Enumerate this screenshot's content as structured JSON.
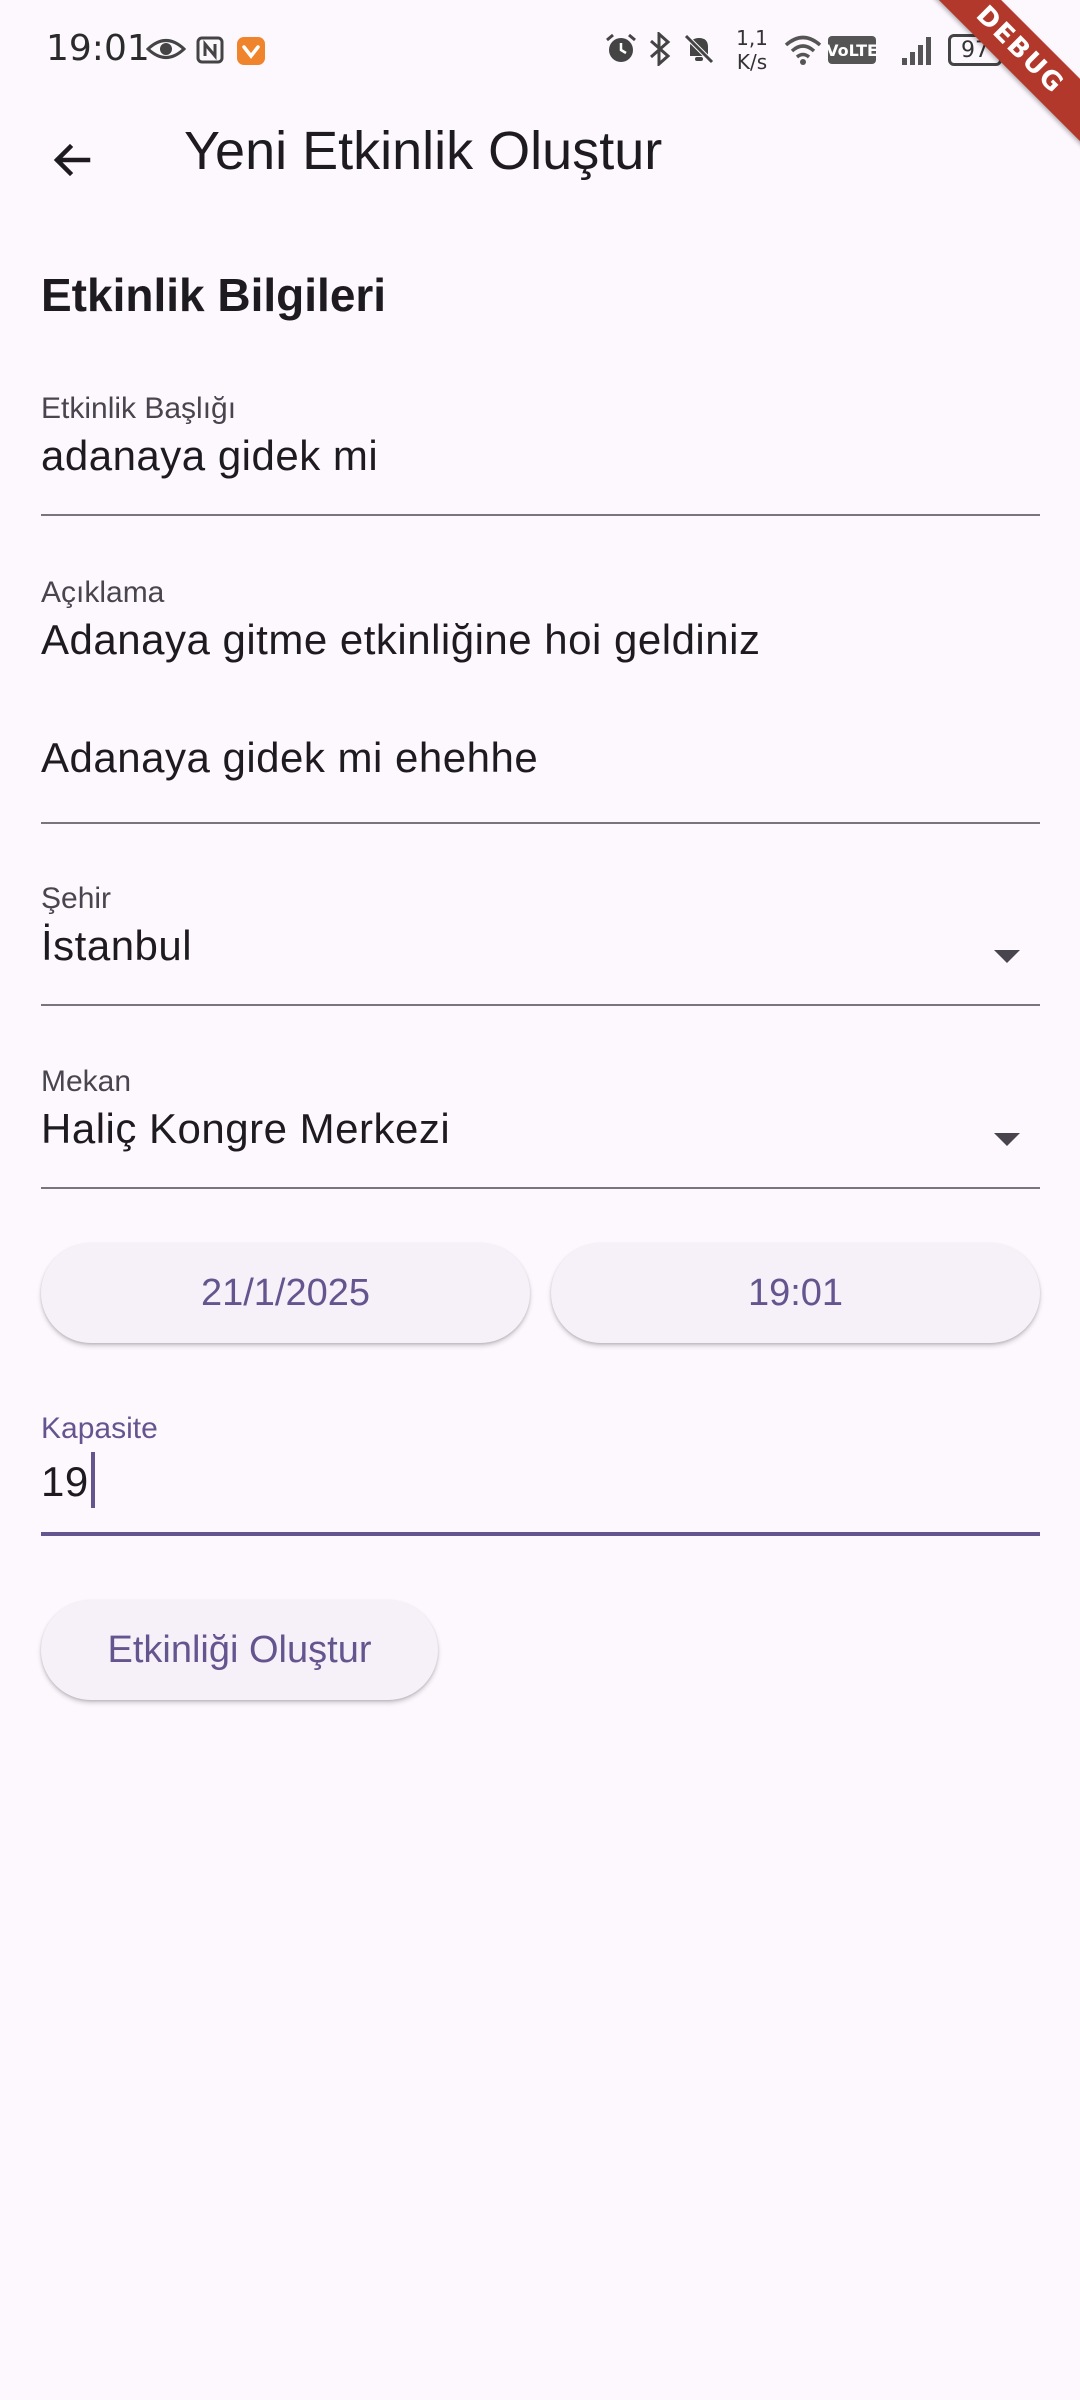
{
  "status_bar": {
    "time": "19:01",
    "net_speed_top": "1,1",
    "net_speed_bottom": "K/s",
    "volte": "VoLTE",
    "battery": "97",
    "icons": [
      "eye-icon",
      "nfc-icon",
      "app-notification-icon",
      "alarm-icon",
      "bluetooth-icon",
      "mute-icon",
      "wifi-icon",
      "signal-icon",
      "battery-icon"
    ]
  },
  "debug_banner": "DEBUG",
  "app_bar": {
    "title": "Yeni Etkinlik Oluştur",
    "back_icon": "arrow-back-icon"
  },
  "form": {
    "section_title": "Etkinlik Bilgileri",
    "title_field": {
      "label": "Etkinlik Başlığı",
      "value": "adanaya gidek mi"
    },
    "description_field": {
      "label": "Açıklama",
      "value_line1": "Adanaya gitme etkinliğine hoi geldiniz",
      "value_line2": "Adanaya gidek mi ehehhe"
    },
    "city_field": {
      "label": "Şehir",
      "value": "İstanbul"
    },
    "venue_field": {
      "label": "Mekan",
      "value": "Haliç Kongre Merkezi"
    },
    "date_button": "21/1/2025",
    "time_button": "19:01",
    "capacity_field": {
      "label": "Kapasite",
      "value": "19"
    },
    "submit_button": "Etkinliği Oluştur"
  },
  "colors": {
    "background": "#fdf7fe",
    "accent": "#65558f",
    "debug_ribbon": "#b3382c"
  }
}
